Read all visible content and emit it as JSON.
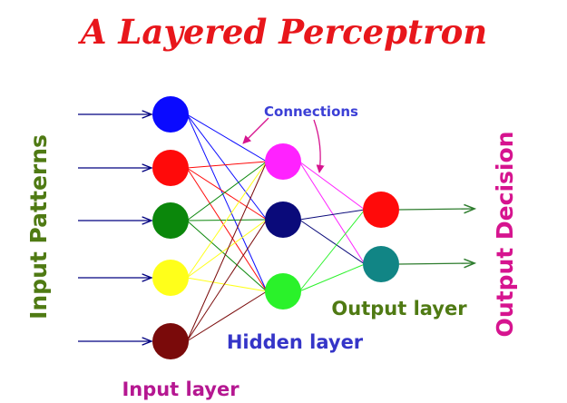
{
  "title": {
    "text": "A Layered Perceptron",
    "color": "#e8161b"
  },
  "labels": {
    "connections": {
      "text": "Connections",
      "color": "#3b3fd6"
    },
    "input_patterns": {
      "text": "Input Patterns",
      "color": "#4f7a13"
    },
    "output_decision": {
      "text": "Output Decision",
      "color": "#d6148f"
    },
    "hidden_layer": {
      "text": "Hidden layer",
      "color": "#3535c8"
    },
    "output_layer": {
      "text": "Output layer",
      "color": "#4f7a13"
    },
    "input_layer": {
      "text": "Input layer",
      "color": "#b51791"
    }
  },
  "layers": {
    "input": {
      "nodes": [
        {
          "color": "#0a0aff",
          "name": "input-node-1"
        },
        {
          "color": "#ff0a0a",
          "name": "input-node-2"
        },
        {
          "color": "#0b870b",
          "name": "input-node-3"
        },
        {
          "color": "#ffff1a",
          "name": "input-node-4"
        },
        {
          "color": "#7a0a0a",
          "name": "input-node-5"
        }
      ]
    },
    "hidden": {
      "nodes": [
        {
          "color": "#ff22ff",
          "name": "hidden-node-1"
        },
        {
          "color": "#0a0a7a",
          "name": "hidden-node-2"
        },
        {
          "color": "#2af22a",
          "name": "hidden-node-3"
        }
      ]
    },
    "output": {
      "nodes": [
        {
          "color": "#ff0a0a",
          "name": "output-node-1"
        },
        {
          "color": "#118585",
          "name": "output-node-2"
        }
      ]
    }
  },
  "colors": {
    "input_arrow": "#000080",
    "output_arrow": "#2e7d2e",
    "annotation_arrow": "#d6148f"
  }
}
